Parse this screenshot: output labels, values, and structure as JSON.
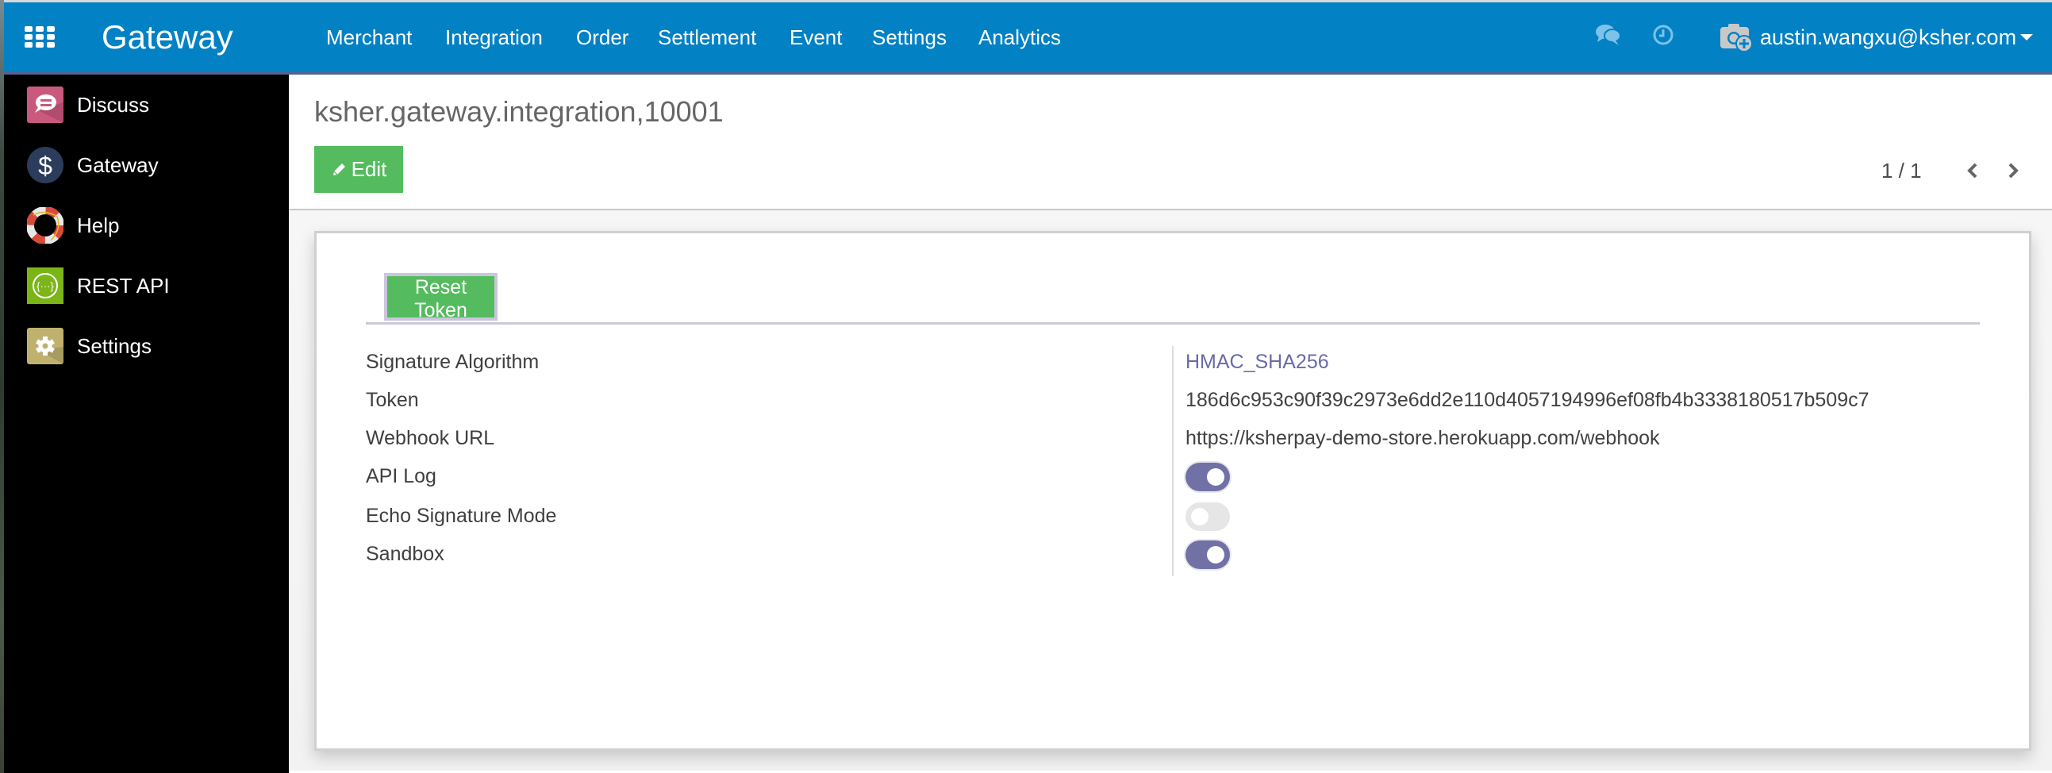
{
  "navbar": {
    "brand": "Gateway",
    "menu": [
      "Merchant",
      "Integration",
      "Order",
      "Settlement",
      "Event",
      "Settings",
      "Analytics"
    ],
    "icons": [
      "chat-icon",
      "clock-icon"
    ],
    "user": "austin.wangxu@ksher.com",
    "colors": {
      "bar": "#0281c4",
      "border": "#5b5e8f"
    }
  },
  "sidebar": {
    "items": [
      {
        "label": "Discuss",
        "icon": "discuss-icon"
      },
      {
        "label": "Gateway",
        "icon": "dollar-icon"
      },
      {
        "label": "Help",
        "icon": "lifebuoy-icon"
      },
      {
        "label": "REST API",
        "icon": "rest-api-icon"
      },
      {
        "label": "Settings",
        "icon": "gear-icon"
      }
    ]
  },
  "control": {
    "title": "ksher.gateway.integration,10001",
    "edit_label": "Edit",
    "pager": "1 / 1"
  },
  "form": {
    "reset_token_label": "Reset Token",
    "fields": [
      {
        "label": "Signature Algorithm",
        "value": "HMAC_SHA256",
        "type": "link"
      },
      {
        "label": "Token",
        "value": "186d6c953c90f39c2973e6dd2e110d4057194996ef08fb4b3338180517b509c7",
        "type": "text"
      },
      {
        "label": "Webhook URL",
        "value": "https://ksherpay-demo-store.herokuapp.com/webhook",
        "type": "text"
      },
      {
        "label": "API Log",
        "value": true,
        "type": "toggle"
      },
      {
        "label": "Echo Signature Mode",
        "value": false,
        "type": "toggle"
      },
      {
        "label": "Sandbox",
        "value": true,
        "type": "toggle"
      }
    ],
    "colors": {
      "button": "#55bb5f",
      "link": "#6a6aa8",
      "toggle_on": "#7171a6"
    }
  }
}
